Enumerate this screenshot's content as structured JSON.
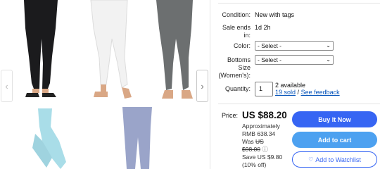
{
  "gallery": {
    "prev_glyph": "‹",
    "next_glyph": "›",
    "colors": {
      "black": "#1b1b1d",
      "white": "#f2f2f2",
      "gray": "#6c6f70",
      "light_blue": "#a9dde8",
      "lavender": "#9aa4c9",
      "skin": "#d9a785"
    }
  },
  "details": {
    "condition_label": "Condition:",
    "condition_value": "New with tags",
    "sale_ends_label_1": "Sale ends",
    "sale_ends_label_2": "in:",
    "sale_ends_value": "1d 2h",
    "color_label": "Color:",
    "color_select": "- Select -",
    "size_label_1": "Bottoms",
    "size_label_2": "Size",
    "size_label_3": "(Women's):",
    "size_select": "- Select -",
    "quantity_label": "Quantity:",
    "quantity_value": "1",
    "available": "2 available",
    "sold": "19 sold",
    "slash": "/",
    "feedback": "See feedback"
  },
  "pricing": {
    "price_label": "Price:",
    "price": "US $88.20",
    "approx_1": "Approximately",
    "approx_2": "RMB 638.34",
    "was_prefix": "Was ",
    "was_1": "US",
    "was_2": "$98.00",
    "info_icon": "ⓘ",
    "save_1": "Save US $9.80",
    "save_2": "(10% off)"
  },
  "actions": {
    "buy_now": "Buy It Now",
    "add_to_cart": "Add to cart",
    "add_to_watchlist": "Add to Watchlist",
    "heart_glyph": "♡",
    "accent": "#3665f3"
  }
}
